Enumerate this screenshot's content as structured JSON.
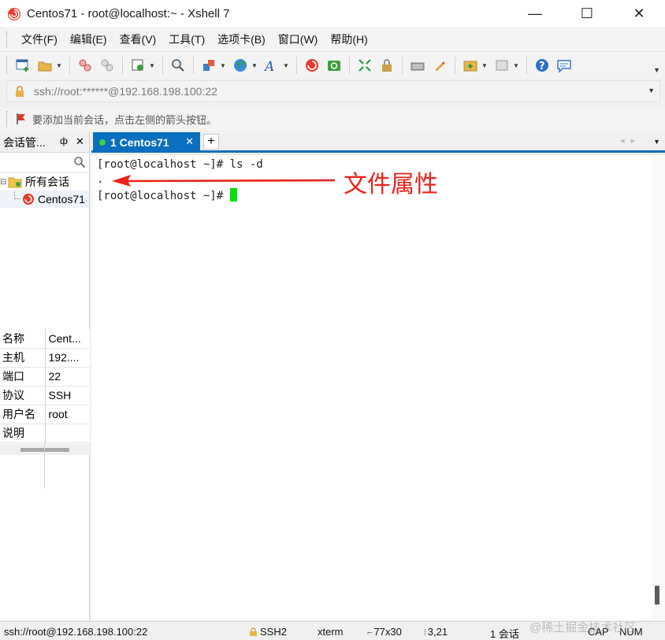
{
  "window": {
    "title": "Centos71 - root@localhost:~ - Xshell 7",
    "minimize_glyph": "—",
    "maximize_glyph": "☐",
    "close_glyph": "✕"
  },
  "menu": [
    "文件(F)",
    "编辑(E)",
    "查看(V)",
    "工具(T)",
    "选项卡(B)",
    "窗口(W)",
    "帮助(H)"
  ],
  "address": {
    "text": "ssh://root:******@192.168.198.100:22"
  },
  "hint": {
    "text": "要添加当前会话，点击左侧的箭头按钮。"
  },
  "session_manager": {
    "title": "会话管...",
    "pin_glyph": "ф",
    "close_glyph": "✕",
    "tree_root": "所有会话",
    "tree_child": "Centos71"
  },
  "properties": [
    {
      "key": "名称",
      "value": "Cent..."
    },
    {
      "key": "主机",
      "value": "192...."
    },
    {
      "key": "端口",
      "value": "22"
    },
    {
      "key": "协议",
      "value": "SSH"
    },
    {
      "key": "用户名",
      "value": "root"
    },
    {
      "key": "说明",
      "value": ""
    }
  ],
  "tab": {
    "label": "1 Centos71",
    "close_glyph": "✕",
    "add_glyph": "+"
  },
  "terminal": {
    "line1": "[root@localhost ~]# ls -d",
    "line2": ".",
    "line3": "[root@localhost ~]# "
  },
  "annotation": {
    "text": "文件属性",
    "color": "#e8231a"
  },
  "status": {
    "connection": "ssh://root@192.168.198.100:22",
    "protocol": "SSH2",
    "terminal_type": "xterm",
    "size": "77x30",
    "cursor_pos": "3,21",
    "sessions": "1 会话",
    "caps": "CAP",
    "num": "NUM"
  },
  "watermark": "@稀土掘金技术社区",
  "colors": {
    "accent": "#0a6fbe",
    "cursor": "#00e000",
    "annotation": "#e8231a"
  }
}
